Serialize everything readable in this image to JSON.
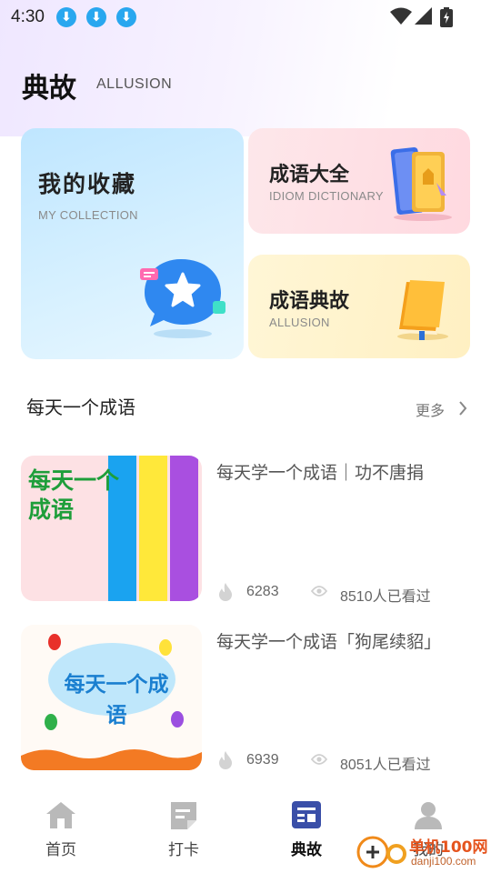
{
  "status": {
    "time": "4:30"
  },
  "header": {
    "title": "典故",
    "subtitle": "ALLUSION"
  },
  "cards": {
    "collection": {
      "title": "我的收藏",
      "subtitle": "MY COLLECTION"
    },
    "dictionary": {
      "title": "成语大全",
      "subtitle": "IDIOM DICTIONARY"
    },
    "allusion": {
      "title": "成语典故",
      "subtitle": "ALLUSION"
    }
  },
  "section": {
    "title": "每天一个成语",
    "more": "更多"
  },
  "articles": [
    {
      "title": "每天学一个成语｜功不唐捐",
      "thumb_text": "每天一个成语",
      "likes": "6283",
      "views": "8510人已看过"
    },
    {
      "title": "每天学一个成语「狗尾续貂」",
      "thumb_text": "每天一个成语",
      "likes": "6939",
      "views": "8051人已看过"
    }
  ],
  "tabs": [
    {
      "label": "首页",
      "icon": "home-icon"
    },
    {
      "label": "打卡",
      "icon": "checkin-icon"
    },
    {
      "label": "典故",
      "icon": "allusion-icon",
      "active": true
    },
    {
      "label": "我的",
      "icon": "profile-icon"
    }
  ],
  "watermark": {
    "text": "danji100.com",
    "brand": "单机100网"
  },
  "colors": {
    "accent": "#3a4fa8",
    "download_badge": "#29a7ef"
  }
}
